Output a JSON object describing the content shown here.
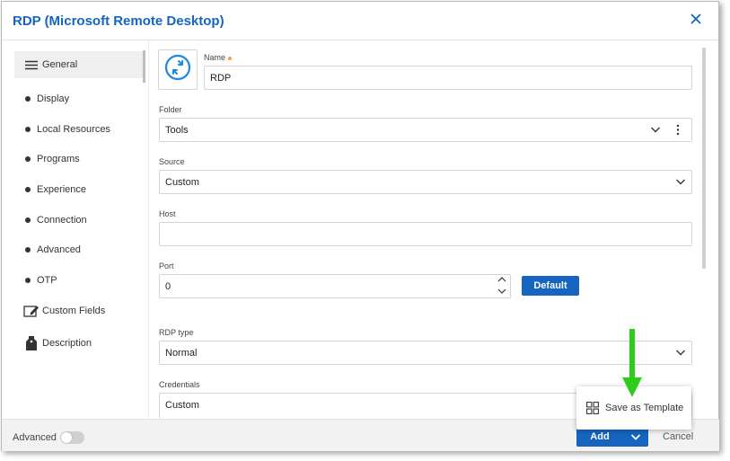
{
  "dialog": {
    "title": "RDP (Microsoft Remote Desktop)"
  },
  "sidebar": {
    "items": [
      {
        "label": "General",
        "icon": "hamburger-icon",
        "active": true
      },
      {
        "label": "Display"
      },
      {
        "label": "Local Resources"
      },
      {
        "label": "Programs"
      },
      {
        "label": "Experience"
      },
      {
        "label": "Connection"
      },
      {
        "label": "Advanced"
      },
      {
        "label": "OTP"
      },
      {
        "label": "Custom Fields",
        "icon": "edit-icon"
      },
      {
        "label": "Description",
        "icon": "tag-icon"
      }
    ]
  },
  "form": {
    "name_label": "Name",
    "name_value": "RDP",
    "folder_label": "Folder",
    "folder_value": "Tools",
    "source_label": "Source",
    "source_value": "Custom",
    "host_label": "Host",
    "host_value": "",
    "port_label": "Port",
    "port_value": "0",
    "default_button": "Default",
    "rdp_type_label": "RDP type",
    "rdp_type_value": "Normal",
    "credentials_label": "Credentials",
    "credentials_value": "Custom"
  },
  "footer": {
    "advanced_label": "Advanced",
    "advanced_enabled": false,
    "add_label": "Add",
    "cancel_label": "Cancel"
  },
  "popup": {
    "save_template_label": "Save as Template"
  },
  "colors": {
    "accent": "#1565c0",
    "required_dot": "#f5a623",
    "annotation_arrow": "#2ecc1a"
  }
}
